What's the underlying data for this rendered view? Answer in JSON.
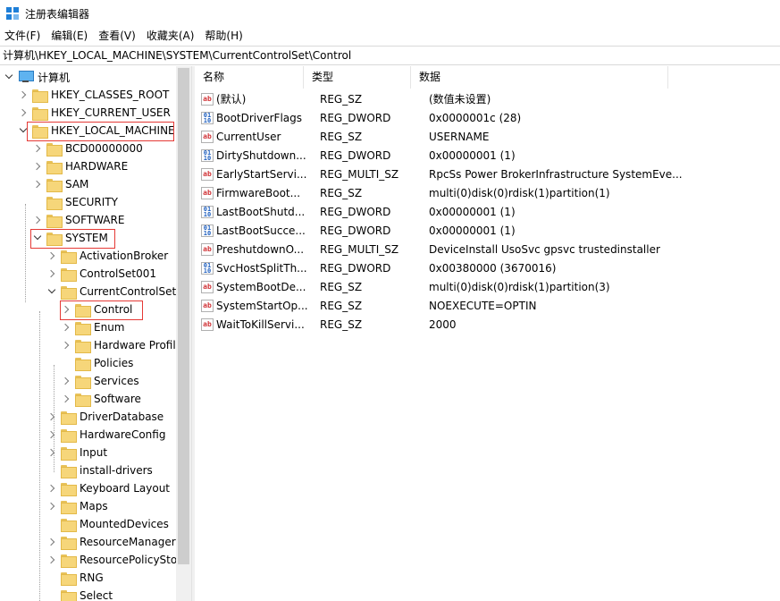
{
  "window": {
    "title": "注册表编辑器"
  },
  "menu": [
    "文件(F)",
    "编辑(E)",
    "查看(V)",
    "收藏夹(A)",
    "帮助(H)"
  ],
  "address": "计算机\\HKEY_LOCAL_MACHINE\\SYSTEM\\CurrentControlSet\\Control",
  "tree": [
    {
      "label": "计算机",
      "level": 0,
      "state": "expanded",
      "icon": "computer-icon"
    },
    {
      "label": "HKEY_CLASSES_ROOT",
      "level": 1,
      "state": "collapsed"
    },
    {
      "label": "HKEY_CURRENT_USER",
      "level": 1,
      "state": "collapsed"
    },
    {
      "label": "HKEY_LOCAL_MACHINE",
      "level": 1,
      "state": "expanded",
      "highlight": true
    },
    {
      "label": "BCD00000000",
      "level": 2,
      "state": "collapsed"
    },
    {
      "label": "HARDWARE",
      "level": 2,
      "state": "collapsed"
    },
    {
      "label": "SAM",
      "level": 2,
      "state": "collapsed"
    },
    {
      "label": "SECURITY",
      "level": 2,
      "state": "none"
    },
    {
      "label": "SOFTWARE",
      "level": 2,
      "state": "collapsed"
    },
    {
      "label": "SYSTEM",
      "level": 2,
      "state": "expanded",
      "highlight": true
    },
    {
      "label": "ActivationBroker",
      "level": 3,
      "state": "collapsed"
    },
    {
      "label": "ControlSet001",
      "level": 3,
      "state": "collapsed"
    },
    {
      "label": "CurrentControlSet",
      "level": 3,
      "state": "expanded"
    },
    {
      "label": "Control",
      "level": 4,
      "state": "collapsed",
      "highlight": true,
      "selected": true
    },
    {
      "label": "Enum",
      "level": 4,
      "state": "collapsed"
    },
    {
      "label": "Hardware Profil",
      "level": 4,
      "state": "collapsed"
    },
    {
      "label": "Policies",
      "level": 4,
      "state": "none"
    },
    {
      "label": "Services",
      "level": 4,
      "state": "collapsed"
    },
    {
      "label": "Software",
      "level": 4,
      "state": "collapsed"
    },
    {
      "label": "DriverDatabase",
      "level": 3,
      "state": "collapsed"
    },
    {
      "label": "HardwareConfig",
      "level": 3,
      "state": "collapsed"
    },
    {
      "label": "Input",
      "level": 3,
      "state": "collapsed"
    },
    {
      "label": "install-drivers",
      "level": 3,
      "state": "none"
    },
    {
      "label": "Keyboard Layout",
      "level": 3,
      "state": "collapsed"
    },
    {
      "label": "Maps",
      "level": 3,
      "state": "collapsed"
    },
    {
      "label": "MountedDevices",
      "level": 3,
      "state": "none"
    },
    {
      "label": "ResourceManager",
      "level": 3,
      "state": "collapsed"
    },
    {
      "label": "ResourcePolicySto",
      "level": 3,
      "state": "collapsed"
    },
    {
      "label": "RNG",
      "level": 3,
      "state": "none"
    },
    {
      "label": "Select",
      "level": 3,
      "state": "none"
    }
  ],
  "columns": {
    "name": "名称",
    "type": "类型",
    "data": "数据"
  },
  "values": [
    {
      "name": "(默认)",
      "type": "REG_SZ",
      "data": "(数值未设置)",
      "icon": "sz"
    },
    {
      "name": "BootDriverFlags",
      "type": "REG_DWORD",
      "data": "0x0000001c (28)",
      "icon": "dword"
    },
    {
      "name": "CurrentUser",
      "type": "REG_SZ",
      "data": "USERNAME",
      "icon": "sz"
    },
    {
      "name": "DirtyShutdown...",
      "type": "REG_DWORD",
      "data": "0x00000001 (1)",
      "icon": "dword"
    },
    {
      "name": "EarlyStartServi...",
      "type": "REG_MULTI_SZ",
      "data": "RpcSs Power BrokerInfrastructure SystemEve...",
      "icon": "sz"
    },
    {
      "name": "FirmwareBoot...",
      "type": "REG_SZ",
      "data": "multi(0)disk(0)rdisk(1)partition(1)",
      "icon": "sz"
    },
    {
      "name": "LastBootShutd...",
      "type": "REG_DWORD",
      "data": "0x00000001 (1)",
      "icon": "dword"
    },
    {
      "name": "LastBootSucce...",
      "type": "REG_DWORD",
      "data": "0x00000001 (1)",
      "icon": "dword"
    },
    {
      "name": "PreshutdownO...",
      "type": "REG_MULTI_SZ",
      "data": "DeviceInstall UsoSvc gpsvc trustedinstaller",
      "icon": "sz"
    },
    {
      "name": "SvcHostSplitTh...",
      "type": "REG_DWORD",
      "data": "0x00380000 (3670016)",
      "icon": "dword"
    },
    {
      "name": "SystemBootDe...",
      "type": "REG_SZ",
      "data": "multi(0)disk(0)rdisk(1)partition(3)",
      "icon": "sz"
    },
    {
      "name": "SystemStartOp...",
      "type": "REG_SZ",
      "data": " NOEXECUTE=OPTIN",
      "icon": "sz"
    },
    {
      "name": "WaitToKillServi...",
      "type": "REG_SZ",
      "data": "2000",
      "icon": "sz"
    }
  ]
}
